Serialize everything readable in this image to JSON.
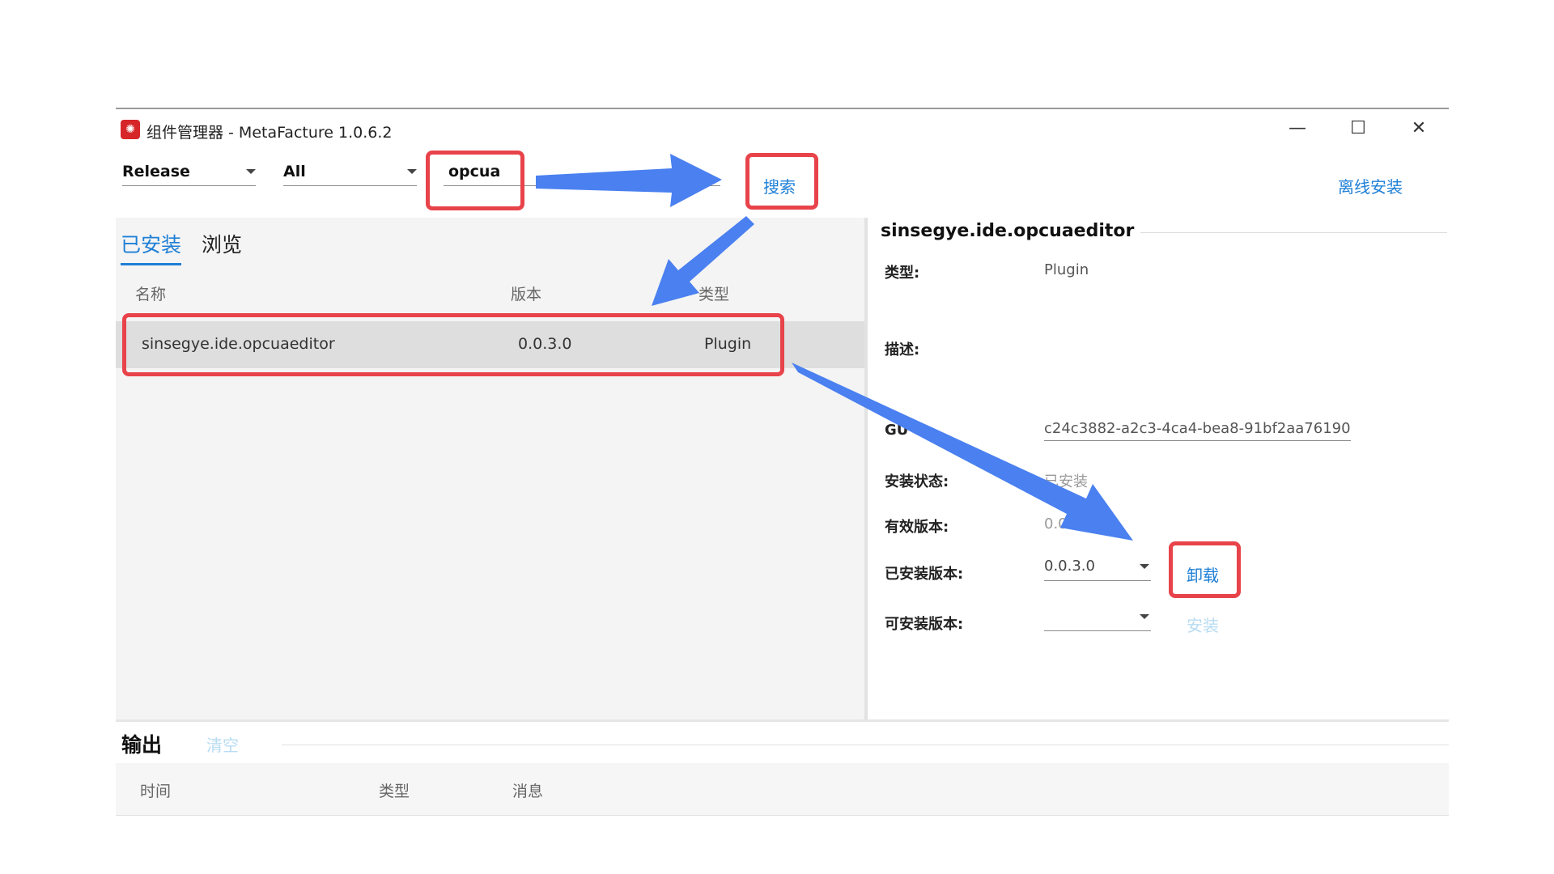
{
  "window": {
    "title": "组件管理器 - MetaFacture 1.0.6.2",
    "icon": "app-logo-icon",
    "minimize_glyph": "—",
    "maximize_glyph": "☐",
    "close_glyph": "✕"
  },
  "toolbar": {
    "channel_value": "Release",
    "category_value": "All",
    "search_value": "opcua",
    "search_button": "搜索",
    "offline_install": "离线安装"
  },
  "tabs": [
    {
      "label": "已安装",
      "active": true
    },
    {
      "label": "浏览",
      "active": false
    }
  ],
  "list": {
    "columns": [
      "名称",
      "版本",
      "类型"
    ],
    "rows": [
      {
        "name": "sinsegye.ide.opcuaeditor",
        "version": "0.0.3.0",
        "type": "Plugin"
      }
    ]
  },
  "detail": {
    "title": "sinsegye.ide.opcuaeditor",
    "type_label": "类型:",
    "type_value": "Plugin",
    "desc_label": "描述:",
    "guid_label": "GU",
    "guid_value": "c24c3882-a2c3-4ca4-bea8-91bf2aa76190",
    "status_label": "安装状态:",
    "status_value": "已安装",
    "effective_label": "有效版本:",
    "effective_value": "0.0.3",
    "installed_label": "已安装版本:",
    "installed_value": "0.0.3.0",
    "uninstall_button": "卸载",
    "available_label": "可安装版本:",
    "available_value": "",
    "install_button": "安装"
  },
  "output": {
    "title": "输出",
    "clear_button": "清空",
    "columns": [
      "时间",
      "类型",
      "消息"
    ]
  },
  "colors": {
    "accent": "#1e7fd6",
    "highlight": "#e8434a",
    "arrow": "#4a80f0"
  }
}
